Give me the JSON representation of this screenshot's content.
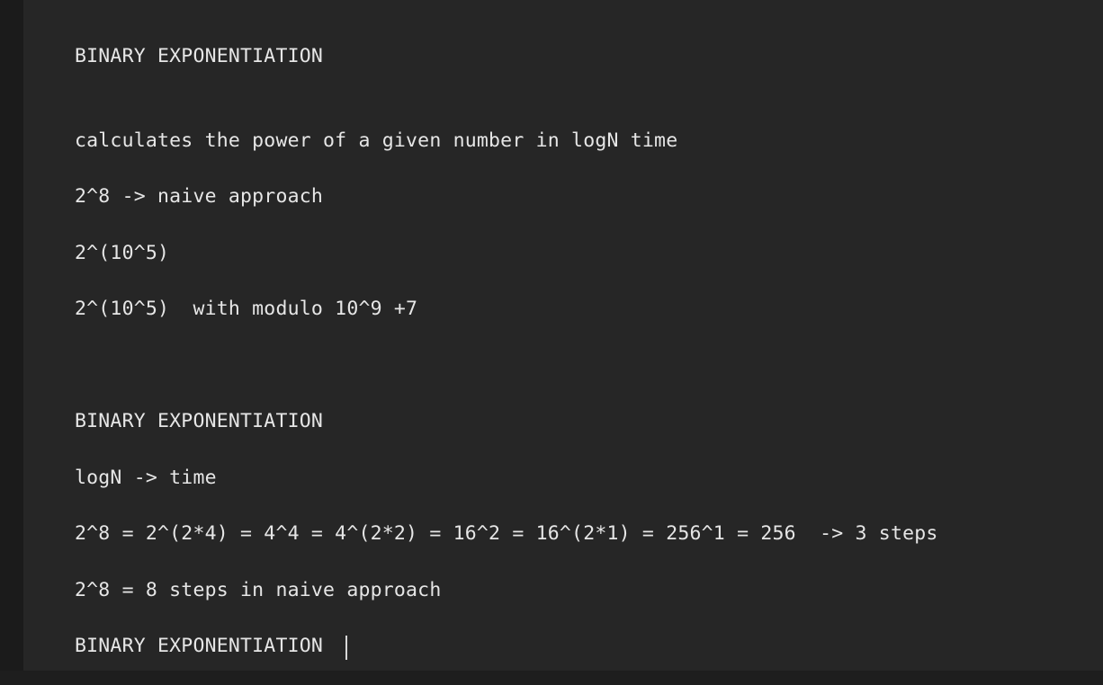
{
  "editor": {
    "lines": [
      "BINARY EXPONENTIATION",
      "calculates the power of a given number in logN time",
      "2^8 -> naive approach",
      "2^(10^5)",
      "2^(10^5)  with modulo 10^9 +7",
      "BINARY EXPONENTIATION",
      "logN -> time",
      "2^8 = 2^(2*4) = 4^4 = 4^(2*2) = 16^2 = 16^(2*1) = 256^1 = 256  -> 3 steps",
      "2^8 = 8 steps in naive approach",
      "BINARY EXPONENTIATION"
    ]
  },
  "colors": {
    "background": "#262626",
    "text": "#e6e6e6"
  }
}
